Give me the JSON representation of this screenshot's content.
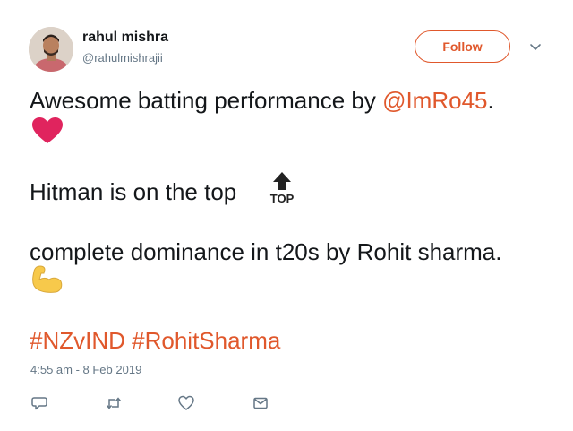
{
  "tweet": {
    "author_name": "rahul mishra",
    "author_handle": "@rahulmishrajii",
    "follow_label": "Follow",
    "line1_text": "Awesome batting performance by ",
    "line1_mention": "@ImRo45",
    "line1_end": ".",
    "line2_text": "Hitman is on the top",
    "line3_text": "complete dominance in t20s by Rohit sharma.",
    "hashtags": [
      "#NZvIND",
      "#RohitSharma"
    ],
    "timestamp": "4:55 am - 8 Feb 2019",
    "top_emoji_text": "TOP"
  },
  "colors": {
    "accent": "#e0582c",
    "text": "#14171a",
    "muted": "#657786",
    "heart": "#e0245e",
    "muscle": "#f7c94b"
  },
  "icons": {
    "chevron": "chevron-down-icon",
    "reply": "reply-icon",
    "retweet": "retweet-icon",
    "like": "heart-outline-icon",
    "dm": "mail-icon"
  }
}
